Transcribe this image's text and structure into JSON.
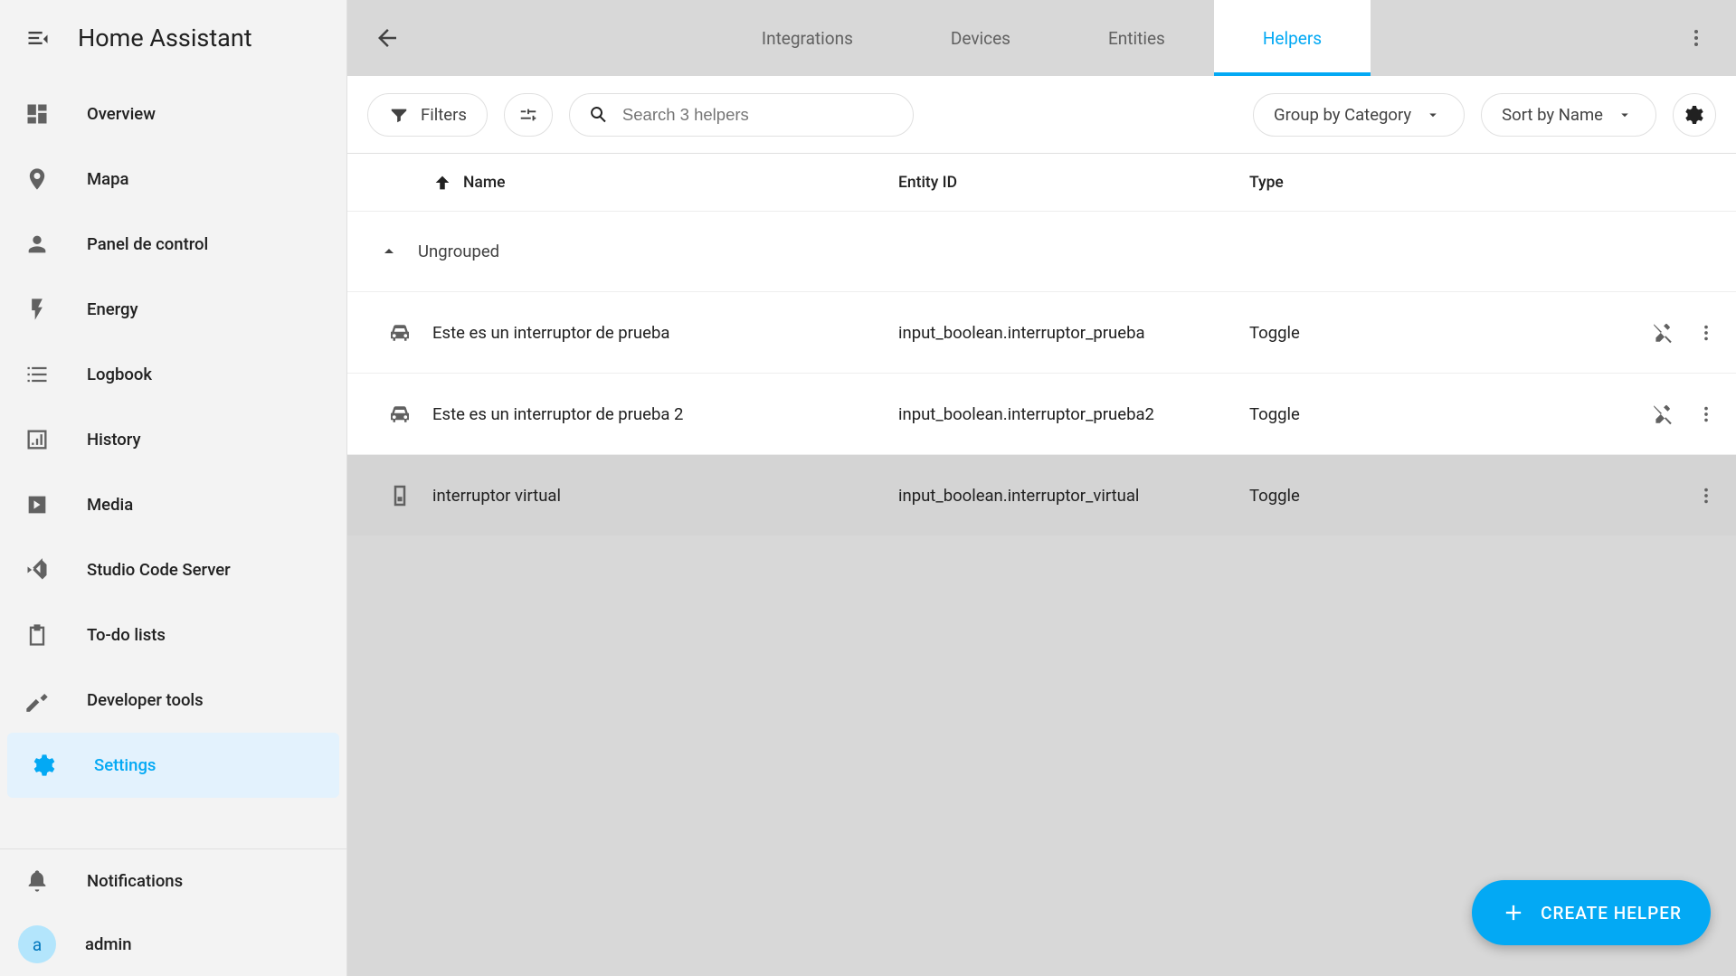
{
  "app_title": "Home Assistant",
  "sidebar": {
    "items": [
      {
        "label": "Overview",
        "icon": "dashboard"
      },
      {
        "label": "Mapa",
        "icon": "map"
      },
      {
        "label": "Panel de control",
        "icon": "account"
      },
      {
        "label": "Energy",
        "icon": "flash"
      },
      {
        "label": "Logbook",
        "icon": "list"
      },
      {
        "label": "History",
        "icon": "chart"
      },
      {
        "label": "Media",
        "icon": "play"
      },
      {
        "label": "Studio Code Server",
        "icon": "code"
      },
      {
        "label": "To-do lists",
        "icon": "clipboard"
      },
      {
        "label": "Developer tools",
        "icon": "hammer"
      },
      {
        "label": "Settings",
        "icon": "gear",
        "active": true
      }
    ],
    "notifications_label": "Notifications",
    "user_label": "admin",
    "user_initial": "a"
  },
  "tabs": [
    {
      "label": "Integrations"
    },
    {
      "label": "Devices"
    },
    {
      "label": "Entities"
    },
    {
      "label": "Helpers",
      "active": true
    }
  ],
  "toolbar": {
    "filters_label": "Filters",
    "search_placeholder": "Search 3 helpers",
    "group_label": "Group by Category",
    "sort_label": "Sort by Name"
  },
  "columns": {
    "name": "Name",
    "entity": "Entity ID",
    "type": "Type"
  },
  "group_label": "Ungrouped",
  "rows": [
    {
      "name": "Este es un interruptor de prueba",
      "entity": "input_boolean.interruptor_prueba",
      "type": "Toggle",
      "icon": "car",
      "editable": true
    },
    {
      "name": "Este es un interruptor de prueba 2",
      "entity": "input_boolean.interruptor_prueba2",
      "type": "Toggle",
      "icon": "car",
      "editable": true
    },
    {
      "name": "interruptor virtual",
      "entity": "input_boolean.interruptor_virtual",
      "type": "Toggle",
      "icon": "switch",
      "editable": false,
      "highlighted": true
    }
  ],
  "fab_label": "CREATE HELPER"
}
